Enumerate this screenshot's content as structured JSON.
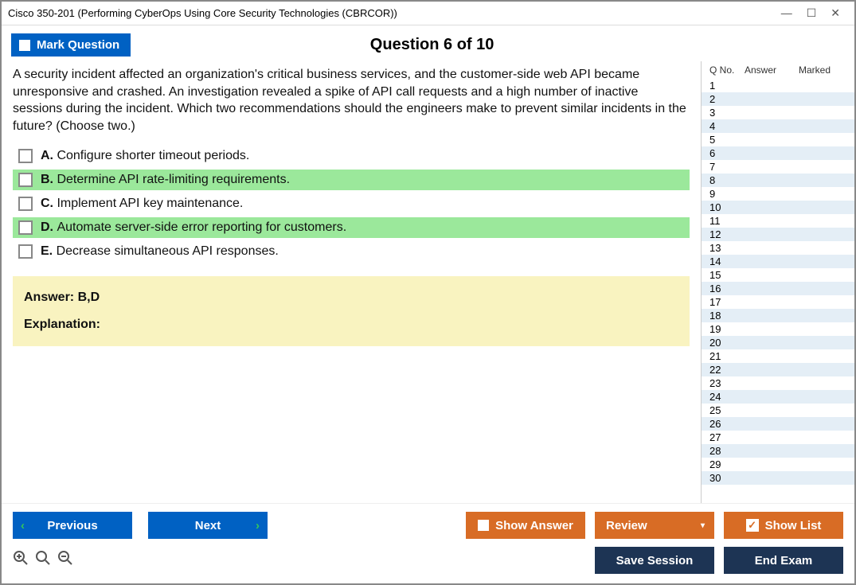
{
  "window": {
    "title": "Cisco 350-201 (Performing CyberOps Using Core Security Technologies (CBRCOR))"
  },
  "header": {
    "mark_question": "Mark Question",
    "question_title": "Question 6 of 10"
  },
  "question": {
    "text": "A security incident affected an organization's critical business services, and the customer-side web API became unresponsive and crashed. An investigation revealed a spike of API call requests and a high number of inactive sessions during the incident. Which two recommendations should the engineers make to prevent similar incidents in the future? (Choose two.)",
    "options": [
      {
        "letter": "A.",
        "text": "Configure shorter timeout periods.",
        "highlighted": false
      },
      {
        "letter": "B.",
        "text": "Determine API rate-limiting requirements.",
        "highlighted": true
      },
      {
        "letter": "C.",
        "text": "Implement API key maintenance.",
        "highlighted": false
      },
      {
        "letter": "D.",
        "text": "Automate server-side error reporting for customers.",
        "highlighted": true
      },
      {
        "letter": "E.",
        "text": "Decrease simultaneous API responses.",
        "highlighted": false
      }
    ],
    "answer_label": "Answer: ",
    "answer_value": "B,D",
    "explanation_label": "Explanation:"
  },
  "sidebar": {
    "headers": {
      "qno": "Q No.",
      "answer": "Answer",
      "marked": "Marked"
    },
    "rows": [
      1,
      2,
      3,
      4,
      5,
      6,
      7,
      8,
      9,
      10,
      11,
      12,
      13,
      14,
      15,
      16,
      17,
      18,
      19,
      20,
      21,
      22,
      23,
      24,
      25,
      26,
      27,
      28,
      29,
      30
    ]
  },
  "footer": {
    "previous": "Previous",
    "next": "Next",
    "show_answer": "Show Answer",
    "review": "Review",
    "show_list": "Show List",
    "save_session": "Save Session",
    "end_exam": "End Exam"
  }
}
